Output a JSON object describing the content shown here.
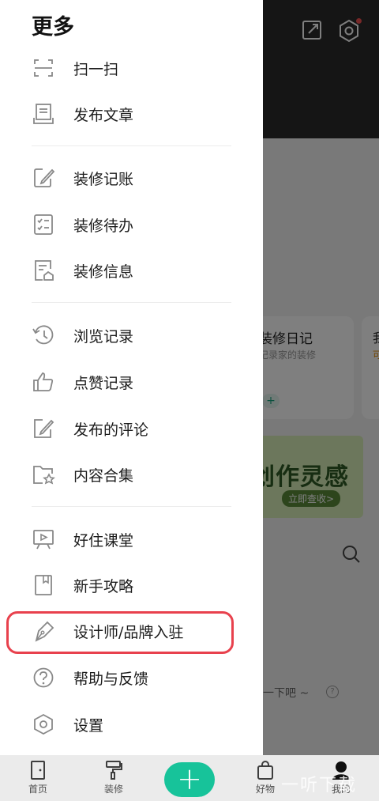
{
  "drawer": {
    "title": "更多",
    "items": [
      {
        "icon": "scan-icon",
        "label": "扫一扫"
      },
      {
        "icon": "publish-article-icon",
        "label": "发布文章"
      },
      {
        "icon": "bookkeeping-icon",
        "label": "装修记账"
      },
      {
        "icon": "todo-icon",
        "label": "装修待办"
      },
      {
        "icon": "house-info-icon",
        "label": "装修信息"
      },
      {
        "icon": "history-icon",
        "label": "浏览记录"
      },
      {
        "icon": "thumbs-up-icon",
        "label": "点赞记录"
      },
      {
        "icon": "comment-edit-icon",
        "label": "发布的评论"
      },
      {
        "icon": "star-folder-icon",
        "label": "内容合集"
      },
      {
        "icon": "video-class-icon",
        "label": "好住课堂"
      },
      {
        "icon": "guide-book-icon",
        "label": "新手攻略"
      },
      {
        "icon": "pen-nib-icon",
        "label": "设计师/品牌入驻"
      },
      {
        "icon": "help-icon",
        "label": "帮助与反馈"
      },
      {
        "icon": "settings-icon",
        "label": "设置"
      }
    ]
  },
  "background": {
    "diary_title": "装修日记",
    "diary_subtitle": "记录家的装修",
    "diary_plus": "+",
    "edge_title": "我",
    "edge_subtitle": "可",
    "banner_title": "创作灵感",
    "banner_button": "立即查收>",
    "hint": "一下吧 ~",
    "hint_icon": "?"
  },
  "tabbar": {
    "tabs": [
      {
        "icon": "home-door-icon",
        "label": "首页"
      },
      {
        "icon": "paint-roller-icon",
        "label": "装修"
      },
      {
        "icon": "shopping-bag-icon",
        "label": "好物"
      },
      {
        "icon": "profile-avatar-icon",
        "label": "我的"
      }
    ],
    "plus_label": "+",
    "watermark": "一听下载"
  },
  "colors": {
    "accent": "#17c39a",
    "highlight_border": "#e8414d"
  }
}
